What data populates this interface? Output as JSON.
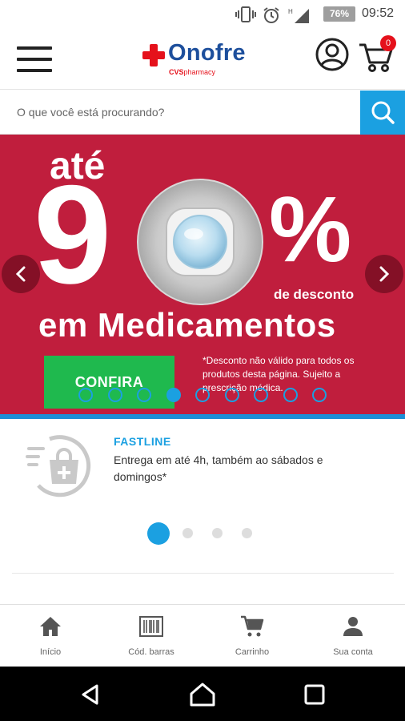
{
  "status_bar": {
    "battery_percent": "76%",
    "time": "09:52",
    "icons": [
      "vibrate-icon",
      "alarm-icon",
      "signal-icon",
      "battery-icon"
    ]
  },
  "header": {
    "logo_text": "Onofre",
    "logo_sub_brand": "CVS",
    "logo_sub_text": "pharmacy",
    "cart_count": "0",
    "icons": [
      "menu-icon",
      "account-icon",
      "cart-icon"
    ]
  },
  "search": {
    "placeholder": "O que você está procurando?"
  },
  "banner": {
    "line_top": "até",
    "big_number": "9",
    "percent_sign": "%",
    "discount_label": "de desconto",
    "headline": "em Medicamentos",
    "cta_label": "CONFIRA",
    "disclaimer": "*Desconto não válido para todos os produtos desta página. Sujeito a prescrição médica.",
    "slide_count": 9,
    "active_slide": 4
  },
  "feature": {
    "title": "FASTLINE",
    "description": "Entrega em até 4h, também ao sábados e domingos*",
    "page_count": 4,
    "active_page": 1
  },
  "bottom_nav": {
    "items": [
      {
        "label": "Início",
        "icon": "home-icon"
      },
      {
        "label": "Cód. barras",
        "icon": "barcode-icon"
      },
      {
        "label": "Carrinho",
        "icon": "cart-icon"
      },
      {
        "label": "Sua conta",
        "icon": "person-icon"
      }
    ]
  },
  "colors": {
    "brand_blue": "#1d4f9c",
    "brand_red": "#e5111b",
    "accent_cyan": "#1ba0e1",
    "banner_red": "#c01e3d",
    "cta_green": "#1fb94e"
  }
}
